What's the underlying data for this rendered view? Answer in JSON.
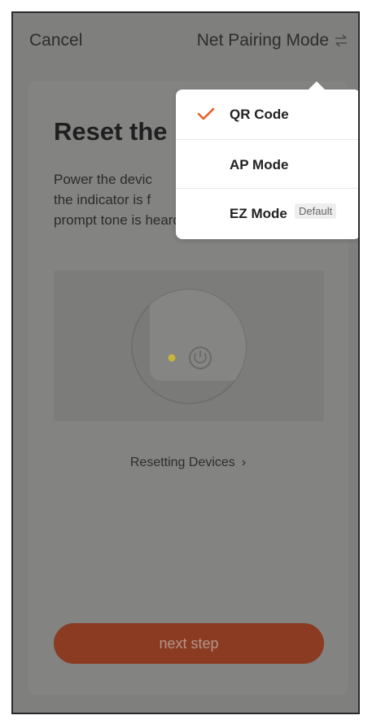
{
  "header": {
    "cancel_label": "Cancel",
    "mode_label": "Net Pairing Mode",
    "mode_icon": "swap-arrows-icon"
  },
  "card": {
    "title": "Reset the",
    "description": "Power the devic the indicator is f prompt tone is heard",
    "resetting_link": "Resetting Devices",
    "next_button": "next step"
  },
  "menu": {
    "items": [
      {
        "label": "QR Code",
        "selected": true
      },
      {
        "label": "AP Mode",
        "selected": false
      },
      {
        "label": "EZ Mode",
        "selected": false,
        "badge": "Default"
      }
    ]
  },
  "colors": {
    "accent": "#e8602c",
    "overlay": "#7f807e",
    "indicator_led": "#c9b43a"
  }
}
